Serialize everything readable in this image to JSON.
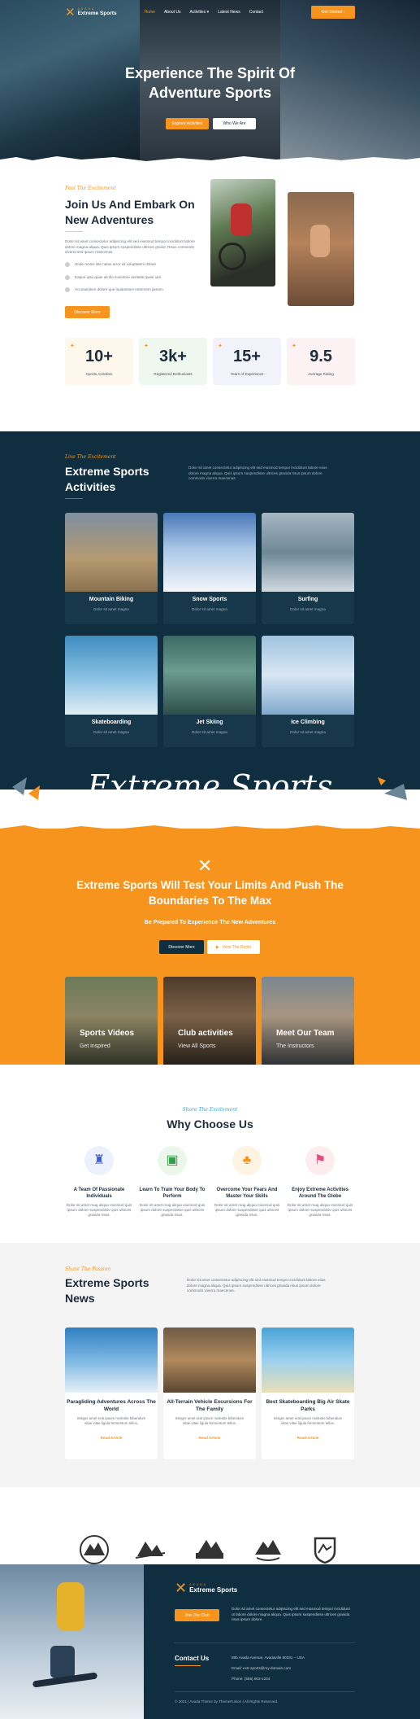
{
  "brand": {
    "small": "ASADA",
    "name": "Extreme Sports"
  },
  "nav": {
    "items": [
      "Home",
      "About Us",
      "Activities",
      "Latest News",
      "Contact"
    ],
    "cta": "Get Started"
  },
  "hero": {
    "title_line1": "Experience The Spirit Of",
    "title_line2": "Adventure Sports",
    "btn1": "Explore Activities",
    "btn2": "Who We Are"
  },
  "about": {
    "eyebrow": "Feel The Excitement",
    "title": "Join Us And Embark On New Adventures",
    "text": "Dolor sit amet consectetur adipiscing elit sed eiusmod tempor incididunt labore dolore magna aliqua. Quis ipsum suspendisse ultrices gravid. Risus commodo viverra sed ipsum maecenas.",
    "bullets": [
      "Unde omnis iste natus error sit voluptatem dolore",
      "Eaque ipsa quae ab illo inventore veritatis quasi iure",
      "Accusantium dolore que laudantium totamrem jamam"
    ],
    "btn": "Discover More"
  },
  "stats": [
    {
      "num": "10+",
      "label": "Sports Activities"
    },
    {
      "num": "3k+",
      "label": "Registered Enthusiasts"
    },
    {
      "num": "15+",
      "label": "Years of Experience"
    },
    {
      "num": "9.5",
      "label": "Average Rating"
    }
  ],
  "activities": {
    "eyebrow": "Live The Excitement",
    "title": "Extreme Sports Activities",
    "text": "Dolor sit amet consectetur adipiscing elit sed eiusmod tempor incididunt labore eiius dolore magna aliqua. Quis ipsum suspendisse ultrices gravida risus ipsum dolore commodo viverra maecenas.",
    "cards": [
      {
        "title": "Mountain Biking",
        "sub": "Dolor sit amet magna"
      },
      {
        "title": "Snow Sports",
        "sub": "Dolor sit amet magna"
      },
      {
        "title": "Surfing",
        "sub": "Dolor sit amet magna"
      },
      {
        "title": "Skateboarding",
        "sub": "Dolor sit amet magna"
      },
      {
        "title": "Jet Skiing",
        "sub": "Dolor sit amet magna"
      },
      {
        "title": "Ice Climbing",
        "sub": "Dolor sit amet magna"
      }
    ]
  },
  "banner": {
    "script": "Extreme Sports"
  },
  "promo": {
    "title_line1": "Extreme Sports Will Test Your Limits And Push The",
    "title_line2": "Boundaries To The Max",
    "sub": "Be Prepared To Experience The New Adventures",
    "btn1": "Discover More",
    "btn2": "View The Demo"
  },
  "promo_cards": [
    {
      "title": "Sports Videos",
      "sub": "Get inspired"
    },
    {
      "title": "Club activities",
      "sub": "View All Sports"
    },
    {
      "title": "Meet Our Team",
      "sub": "The Instructors"
    }
  ],
  "why": {
    "eyebrow": "Share The Excitement",
    "title": "Why Choose Us",
    "items": [
      {
        "title": "A Team Of Passionate Individuals",
        "text": "Dolor sit amet mag aliqua eiusmod quis ipsum dolore suspendisse quis ultrices gravida risus."
      },
      {
        "title": "Learn To Train Your Body To Perform",
        "text": "Dolor sit amet mag aliqua eiusmod quis ipsum dolore suspendisse quis ultrices gravida risus."
      },
      {
        "title": "Overcome Your Fears And Master Your Skills",
        "text": "Dolor sit amet mag aliqua eiusmod quis ipsum dolore suspendisse quis ultrices gravida risus."
      },
      {
        "title": "Enjoy Extreme Activities Around The Globe",
        "text": "Dolor sit amet mag aliqua eiusmod quis ipsum dolore suspendisse quis ultrices gravida risus."
      }
    ]
  },
  "news": {
    "eyebrow": "Share The Passion",
    "title": "Extreme Sports News",
    "text": "Dolor sit amet consectetur adipiscing elit sed eiusmod tempor incididunt labore eiius dolore magna aliqua. Quis ipsum suspendisse ultrices gravida risus ipsum dolore commodo viverra maecenas.",
    "items": [
      {
        "title": "Paragliding Adventures Across The World",
        "text": "Integer amet erat ipsum molestie bibendum vitae vitae ligula fermentum tellus."
      },
      {
        "title": "All-Terrain Vehicle Excursions For The Family",
        "text": "Integer amet erat ipsum molestie bibendum vitae vitae ligula fermentum tellus."
      },
      {
        "title": "Best Skateboarding Big Air Skate Parks",
        "text": "Integer amet erat ipsum molestie bibendum vitae vitae ligula fermentum tellus."
      }
    ],
    "read": "Read Article"
  },
  "footer": {
    "btn": "Join Our Club",
    "text": "Dolor sit amet consectetur adipiscing elit sed eiusmod tempor incididunt ut labore dolore magna aliqua. Quis ipsum suspendisse ultrices gravida risus ipsum dolore.",
    "contact_title": "Contact Us",
    "address": "89b Avada Avenue, Avadaville 90331 – USA",
    "email": "Email: extr-sports@my-domain.com",
    "phone": "Phone: (555) 802-1234",
    "copyright": "© 2021 | Avada Theme by ThemeFusion | All Rights Reserved."
  },
  "colors": {
    "accent": "#f7941d",
    "navy": "#0f2e40"
  }
}
